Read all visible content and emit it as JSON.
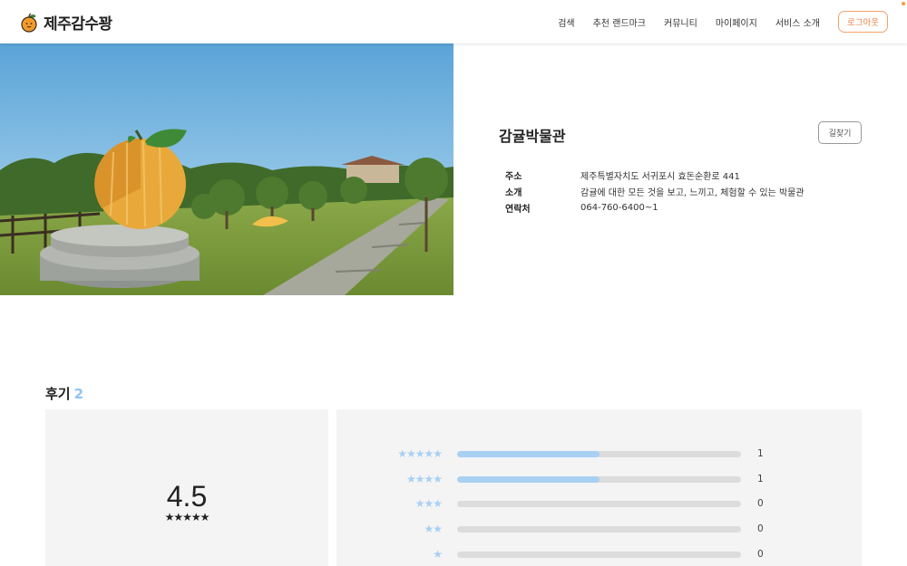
{
  "header": {
    "logo_text": "제주감수꽝",
    "nav": [
      "검색",
      "추천 랜드마크",
      "커뮤니티",
      "마이페이지",
      "서비스 소개"
    ],
    "logout_label": "로그아웃",
    "accent_color": "#e8834a"
  },
  "place": {
    "name": "감귤박물관",
    "directions_label": "길찾기",
    "info": [
      {
        "label": "주소",
        "value": "제주특별자치도 서귀포시 효돈순환로 441"
      },
      {
        "label": "소개",
        "value": "감귤에 대한 모든 것을 보고, 느끼고, 체험할 수 있는 박물관"
      },
      {
        "label": "연락처",
        "value": "064-760-6400~1"
      }
    ]
  },
  "reviews": {
    "title": "후기",
    "count": "2",
    "average": "4.5",
    "average_stars": "★★★★★",
    "distribution": [
      {
        "stars": "★★★★★",
        "count": "1",
        "ratio": 0.5
      },
      {
        "stars": "★★★★",
        "count": "1",
        "ratio": 0.5
      },
      {
        "stars": "★★★",
        "count": "0",
        "ratio": 0
      },
      {
        "stars": "★★",
        "count": "0",
        "ratio": 0
      },
      {
        "stars": "★",
        "count": "0",
        "ratio": 0
      }
    ],
    "bar_color": "#a8d0f3"
  }
}
